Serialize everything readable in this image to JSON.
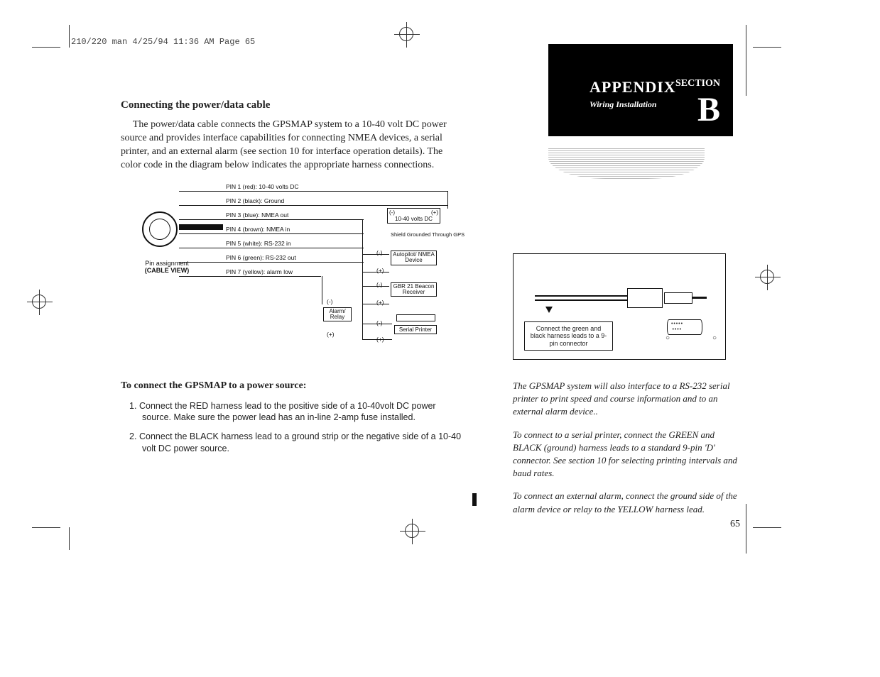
{
  "header": {
    "doc_info": "210/220 man  4/25/94 11:36 AM  Page 65"
  },
  "left": {
    "heading": "Connecting the power/data cable",
    "paragraph": "The power/data cable connects the GPSMAP system to a 10-40 volt DC power source and provides interface capabilities for connecting NMEA devices, a serial printer, and an external alarm (see section 10 for interface operation details). The color code in the diagram below indicates the appropriate harness connections.",
    "diagram": {
      "pin_assign_label": "Pin assignment",
      "pin_assign_sub": "(CABLE VIEW)",
      "pins": [
        "PIN 1 (red): 10-40 volts DC",
        "PIN 2 (black): Ground",
        "PIN 3 (blue): NMEA out",
        "PIN 4 (brown): NMEA in",
        "PIN 5 (white): RS-232 in",
        "PIN 6 (green): RS-232 out",
        "PIN 7 (yellow): alarm low"
      ],
      "power_box": "10-40 volts DC",
      "power_minus": "(-)",
      "power_plus": "(+)",
      "shield_note": "Shield Grounded Through GPS",
      "autopilot_box": "Autopilot/ NMEA Device",
      "gbr_box": "GBR 21 Beacon Receiver",
      "alarm_box": "Alarm/ Relay",
      "printer_box": "Serial Printer",
      "polarity_minus": "(-)",
      "polarity_plus": "(+)"
    },
    "subheading": "To connect the GPSMAP to a power source:",
    "steps": [
      "Connect the RED harness lead to the positive side of a 10-40volt DC power source. Make sure the power lead has an in-line 2-amp fuse installed.",
      "Connect the BLACK harness lead to a ground strip or the negative side of a 10-40 volt DC power source."
    ]
  },
  "right": {
    "appendix": "APPENDIX",
    "appendix_sub": "Wiring Installation",
    "section": "SECTION",
    "section_letter": "B",
    "connector_label": "Connect the green and black harness leads to a 9-pin connector",
    "paragraphs": [
      "The GPSMAP system will also interface to a RS-232 serial printer to print speed and course information and to an external alarm device..",
      "To connect to a serial printer, connect the GREEN and BLACK (ground) harness leads to a standard 9-pin 'D' connector. See section 10 for selecting printing intervals and baud rates.",
      "To connect an external alarm, connect the ground side of the alarm device or relay to the YELLOW harness lead."
    ],
    "page_number": "65"
  }
}
